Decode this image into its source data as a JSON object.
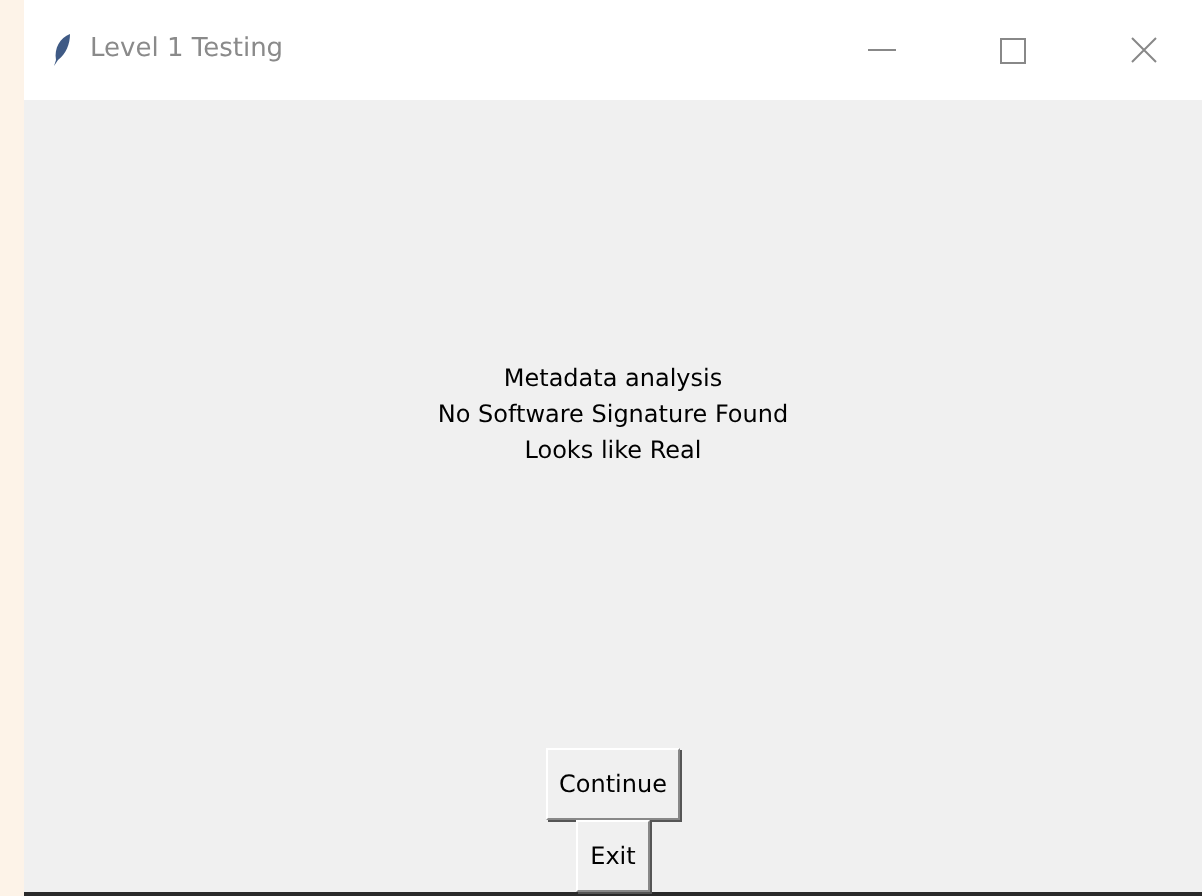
{
  "window": {
    "title": "Level 1 Testing"
  },
  "message": [
    "Metadata analysis",
    "No Software Signature Found",
    "Looks like Real"
  ],
  "buttons": [
    "Continue",
    "Exit"
  ]
}
